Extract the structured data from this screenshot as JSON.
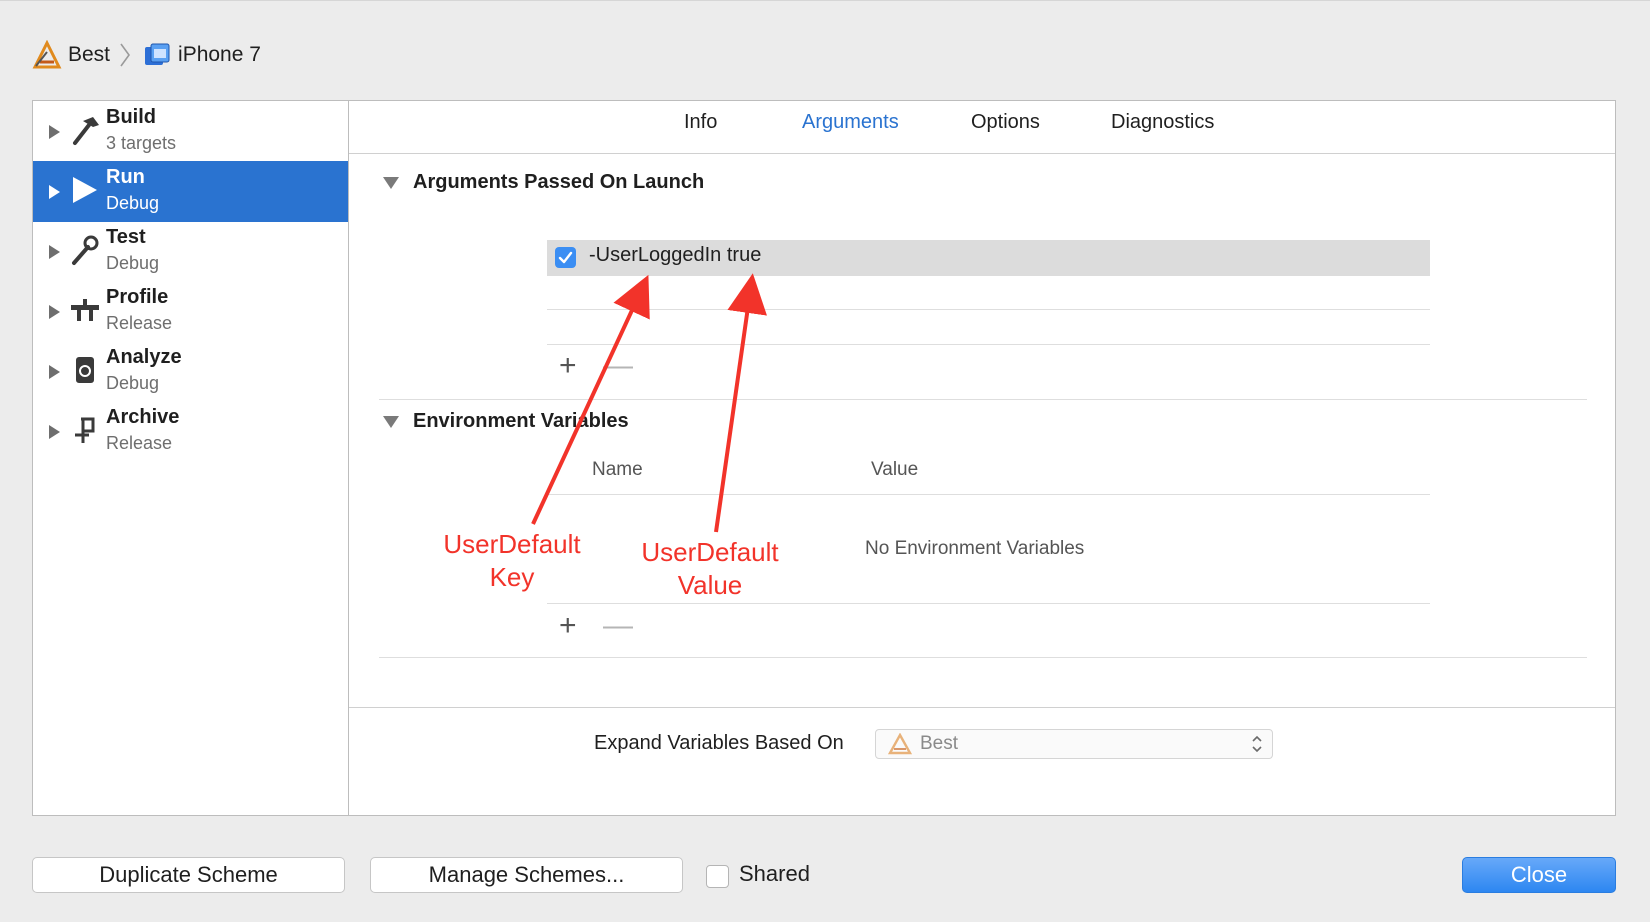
{
  "breadcrumb": {
    "project": "Best",
    "device": "iPhone 7"
  },
  "sidebar": {
    "items": [
      {
        "title": "Build",
        "subtitle": "3 targets"
      },
      {
        "title": "Run",
        "subtitle": "Debug"
      },
      {
        "title": "Test",
        "subtitle": "Debug"
      },
      {
        "title": "Profile",
        "subtitle": "Release"
      },
      {
        "title": "Analyze",
        "subtitle": "Debug"
      },
      {
        "title": "Archive",
        "subtitle": "Release"
      }
    ],
    "selected": "Run"
  },
  "tabs": {
    "info": "Info",
    "arguments": "Arguments",
    "options": "Options",
    "diagnostics": "Diagnostics",
    "active": "Arguments"
  },
  "arguments": {
    "header": "Arguments Passed On Launch",
    "items": [
      {
        "value": "-UserLoggedIn true",
        "checked": true
      }
    ],
    "add": "+",
    "remove": "—"
  },
  "environment": {
    "header": "Environment Variables",
    "columns": {
      "name": "Name",
      "value": "Value"
    },
    "empty": "No Environment Variables",
    "add": "+",
    "remove": "—"
  },
  "expand": {
    "label": "Expand Variables Based On",
    "selected": "Best"
  },
  "footer": {
    "duplicate": "Duplicate Scheme",
    "manage": "Manage Schemes...",
    "shared": "Shared",
    "shared_checked": false,
    "close": "Close"
  },
  "annotations": {
    "key_line1": "UserDefault",
    "key_line2": "Key",
    "value_line1": "UserDefault",
    "value_line2": "Value"
  },
  "colors": {
    "accent": "#2a73d0",
    "annotation": "#f2332a",
    "checkbox": "#3b8ef3"
  }
}
